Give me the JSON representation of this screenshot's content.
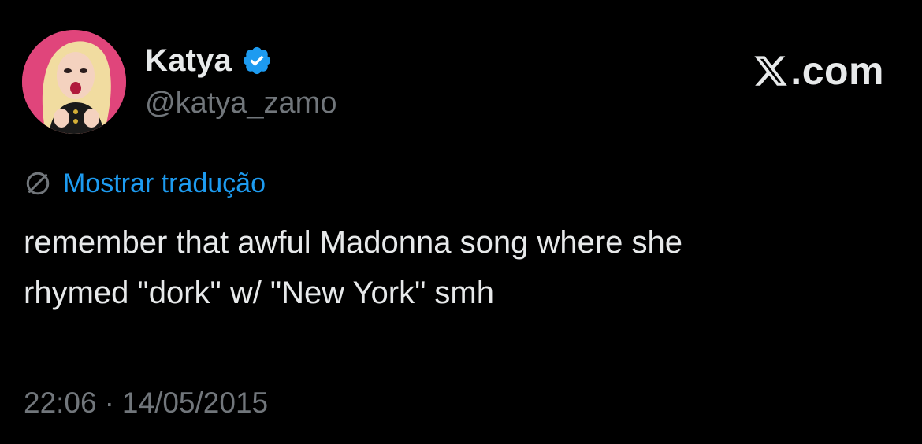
{
  "author": {
    "display_name": "Katya",
    "handle": "@katya_zamo",
    "verified": true,
    "avatar_icon": "profile-photo",
    "avatar_bg": "#e0457b"
  },
  "brand": {
    "icon": "x-logo-icon",
    "text": ".com"
  },
  "translation": {
    "icon": "translate-globe-icon",
    "label": "Mostrar tradução"
  },
  "tweet": {
    "text": "remember that awful Madonna song where she\nrhymed \"dork\" w/ \"New York\" smh"
  },
  "meta": {
    "time": "22:06",
    "separator": "·",
    "date": "14/05/2015"
  },
  "colors": {
    "background": "#000000",
    "text": "#e7e9ea",
    "secondary": "#71767b",
    "accent": "#1d9bf0"
  }
}
